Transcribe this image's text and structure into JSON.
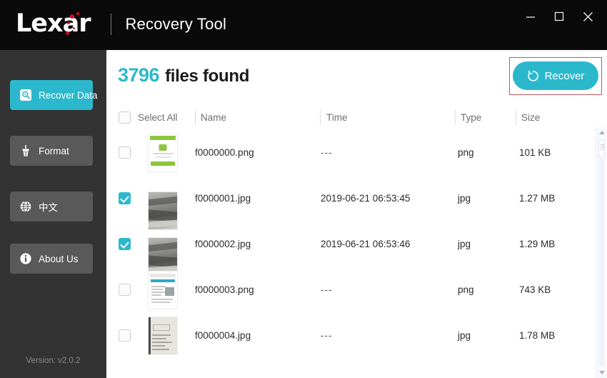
{
  "window": {
    "brand": "Lexar",
    "app_title": "Recovery Tool",
    "controls": {
      "minimize": "minimize-icon",
      "maximize": "maximize-icon",
      "close": "close-icon"
    },
    "accent_color": "#2cb8cc",
    "brand_red": "#d6082a",
    "titlebar_color": "#0a0a0a",
    "sidebar_color": "#333333"
  },
  "sidebar": {
    "items": [
      {
        "label": "Recover Data",
        "icon": "disk-search-icon",
        "active": true
      },
      {
        "label": "Format",
        "icon": "brush-icon",
        "active": false
      },
      {
        "label": "中文",
        "icon": "globe-icon",
        "active": false
      },
      {
        "label": "About Us",
        "icon": "info-icon",
        "active": false
      }
    ],
    "version": "Version: v2.0.2"
  },
  "main": {
    "found_count": "3796",
    "found_label": "files found",
    "recover_button": {
      "label": "Recover",
      "icon": "refresh-circle-icon",
      "highlight_color": "#c05a63"
    },
    "table": {
      "columns": [
        {
          "key": "select",
          "label": "Select All"
        },
        {
          "key": "name",
          "label": "Name"
        },
        {
          "key": "time",
          "label": "Time"
        },
        {
          "key": "type",
          "label": "Type"
        },
        {
          "key": "size",
          "label": "Size"
        }
      ],
      "select_all_checked": false,
      "rows": [
        {
          "checked": false,
          "thumb": "green-app-screenshot",
          "name": "f0000000.png",
          "time": "---",
          "type": "png",
          "size": "101 KB"
        },
        {
          "checked": true,
          "thumb": "gray-photo",
          "name": "f0000001.jpg",
          "time": "2019-06-21 06:53:45",
          "type": "jpg",
          "size": "1.27 MB"
        },
        {
          "checked": true,
          "thumb": "gray-photo",
          "name": "f0000002.jpg",
          "time": "2019-06-21 06:53:46",
          "type": "jpg",
          "size": "1.29 MB"
        },
        {
          "checked": false,
          "thumb": "web-page-screenshot",
          "name": "f0000003.png",
          "time": "---",
          "type": "png",
          "size": "743 KB"
        },
        {
          "checked": false,
          "thumb": "scanned-document",
          "name": "f0000004.jpg",
          "time": "---",
          "type": "jpg",
          "size": "1.78 MB"
        }
      ]
    },
    "scrollbar": {
      "up_arrow": "scroll-up-icon",
      "down_arrow": "scroll-down-icon"
    }
  }
}
